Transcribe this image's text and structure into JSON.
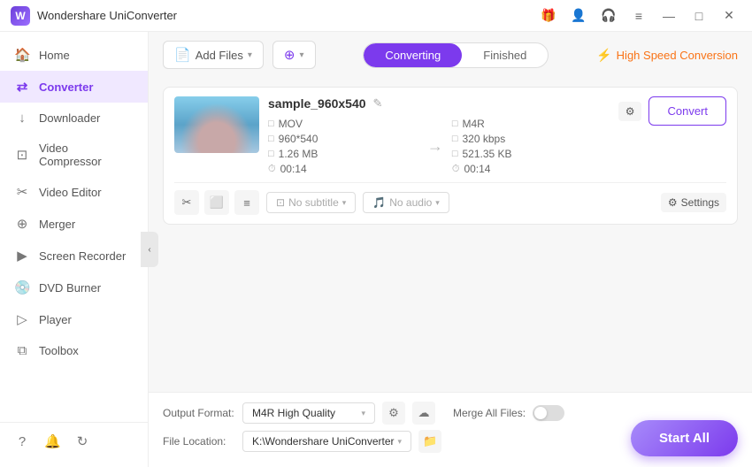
{
  "app": {
    "title": "Wondershare UniConverter",
    "icon_label": "W"
  },
  "titlebar": {
    "controls": {
      "gift_label": "🎁",
      "user_label": "👤",
      "headset_label": "🎧",
      "menu_label": "≡",
      "minimize_label": "—",
      "maximize_label": "□",
      "close_label": "✕"
    }
  },
  "sidebar": {
    "items": [
      {
        "id": "home",
        "label": "Home",
        "icon": "🏠"
      },
      {
        "id": "converter",
        "label": "Converter",
        "icon": "⇄",
        "active": true
      },
      {
        "id": "downloader",
        "label": "Downloader",
        "icon": "↓"
      },
      {
        "id": "video-compressor",
        "label": "Video Compressor",
        "icon": "⊡"
      },
      {
        "id": "video-editor",
        "label": "Video Editor",
        "icon": "✂"
      },
      {
        "id": "merger",
        "label": "Merger",
        "icon": "⊕"
      },
      {
        "id": "screen-recorder",
        "label": "Screen Recorder",
        "icon": "▶"
      },
      {
        "id": "dvd-burner",
        "label": "DVD Burner",
        "icon": "💿"
      },
      {
        "id": "player",
        "label": "Player",
        "icon": "▷"
      },
      {
        "id": "toolbox",
        "label": "Toolbox",
        "icon": "⧉"
      }
    ],
    "bottom_icons": [
      "?",
      "🔔",
      "↻"
    ],
    "collapse_icon": "‹"
  },
  "toolbar": {
    "add_files_label": "Add Files",
    "add_files_icon": "📄",
    "add_files_chevron": "▾",
    "add_shortcut_label": "",
    "add_shortcut_icon": "⊕",
    "add_shortcut_chevron": "▾"
  },
  "tabs": {
    "converting_label": "Converting",
    "finished_label": "Finished"
  },
  "high_speed": {
    "label": "High Speed Conversion",
    "icon": "⚡"
  },
  "file_item": {
    "name": "sample_960x540",
    "edit_icon": "✎",
    "source": {
      "format": "MOV",
      "resolution": "960*540",
      "size": "1.26 MB",
      "duration": "00:14"
    },
    "target": {
      "format": "M4R",
      "bitrate": "320 kbps",
      "size": "521.35 KB",
      "duration": "00:14"
    },
    "subtitle_placeholder": "No subtitle",
    "audio_placeholder": "No audio",
    "convert_btn_label": "Convert",
    "settings_btn_label": "Settings",
    "action_icons": {
      "cut": "✂",
      "crop": "⬜",
      "adjust": "≡"
    }
  },
  "bottom_bar": {
    "output_format_label": "Output Format:",
    "output_format_value": "M4R High Quality",
    "format_icon1": "⚙",
    "format_icon2": "☁",
    "merge_label": "Merge All Files:",
    "file_location_label": "File Location:",
    "file_location_value": "K:\\Wondershare UniConverter",
    "folder_icon": "📁",
    "start_all_label": "Start All"
  }
}
